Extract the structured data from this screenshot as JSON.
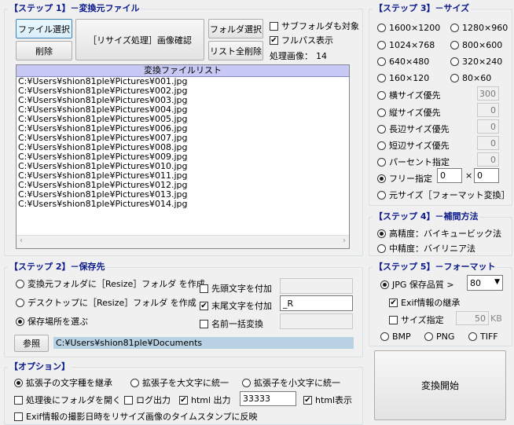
{
  "step1": {
    "title": "【ステップ 1】－変換元ファイル",
    "file_select": "ファイル選択",
    "delete": "削除",
    "resize_check": "［リサイズ処理］画像確認",
    "folder_select": "フォルダ選択",
    "list_clear": "リスト全削除",
    "subfolder_label": "サブフォルダも対象",
    "fullpath_label": "フルパス表示",
    "processed_label": "処理画像：",
    "processed_count": "14",
    "list_header": "変換ファイルリスト",
    "files": [
      "C:¥Users¥shion81ple¥Pictures¥001.jpg",
      "C:¥Users¥shion81ple¥Pictures¥002.jpg",
      "C:¥Users¥shion81ple¥Pictures¥003.jpg",
      "C:¥Users¥shion81ple¥Pictures¥004.jpg",
      "C:¥Users¥shion81ple¥Pictures¥005.jpg",
      "C:¥Users¥shion81ple¥Pictures¥006.jpg",
      "C:¥Users¥shion81ple¥Pictures¥007.jpg",
      "C:¥Users¥shion81ple¥Pictures¥008.jpg",
      "C:¥Users¥shion81ple¥Pictures¥009.jpg",
      "C:¥Users¥shion81ple¥Pictures¥010.jpg",
      "C:¥Users¥shion81ple¥Pictures¥011.jpg",
      "C:¥Users¥shion81ple¥Pictures¥012.jpg",
      "C:¥Users¥shion81ple¥Pictures¥013.jpg",
      "C:¥Users¥shion81ple¥Pictures¥014.jpg"
    ]
  },
  "step2": {
    "title": "【ステップ 2】－保存先",
    "opt_source": "変換元フォルダに［Resize］フォルダ を作成",
    "opt_desktop": "デスクトップに［Resize］フォルダ を作成",
    "opt_choose": "保存場所を選ぶ",
    "prefix_label": "先頭文字を付加",
    "suffix_label": "末尾文字を付加",
    "suffix_value": "_R",
    "rename_label": "名前一括変換",
    "browse": "参照",
    "path": "C:¥Users¥shion81ple¥Documents"
  },
  "options": {
    "title": "【オプション】",
    "ext_keep": "拡張子の文字種を継承",
    "ext_upper": "拡張子を大文字に統一",
    "ext_lower": "拡張子を小文字に統一",
    "open_folder": "処理後にフォルダを開く",
    "log_output": "ログ出力",
    "html_output": "html 出力",
    "html_value": "33333",
    "html_display": "html表示",
    "exif_timestamp": "Exif情報の撮影日時をリサイズ画像のタイムスタンプに反映"
  },
  "step3": {
    "title": "【ステップ 3】－サイズ",
    "sizes": [
      "1600×1200",
      "1280×960",
      "1024×768",
      "800×600",
      "640×480",
      "320×240",
      "160×120",
      "80×60"
    ],
    "width_priority": "横サイズ優先",
    "width_value": "300",
    "height_priority": "縦サイズ優先",
    "height_value": "0",
    "long_priority": "長辺サイズ優先",
    "long_value": "0",
    "short_priority": "短辺サイズ優先",
    "short_value": "0",
    "percent": "パーセント指定",
    "percent_value": "0",
    "free": "フリー指定",
    "free_w": "0",
    "free_x": "×",
    "free_h": "0",
    "original": "元サイズ［フォーマット変換］"
  },
  "step4": {
    "title": "【ステップ 4】－補間方法",
    "high": "高精度：バイキュービック法",
    "mid": "中精度：バイリニア法"
  },
  "step5": {
    "title": "【ステップ 5】－フォーマット",
    "jpg_label": "JPG  保存品質 >",
    "quality": "80",
    "exif_inherit": "Exif情報の継承",
    "size_specify": "サイズ指定",
    "size_value": "50",
    "size_unit": "KB",
    "bmp": "BMP",
    "png": "PNG",
    "tiff": "TIFF"
  },
  "start": "変換開始"
}
